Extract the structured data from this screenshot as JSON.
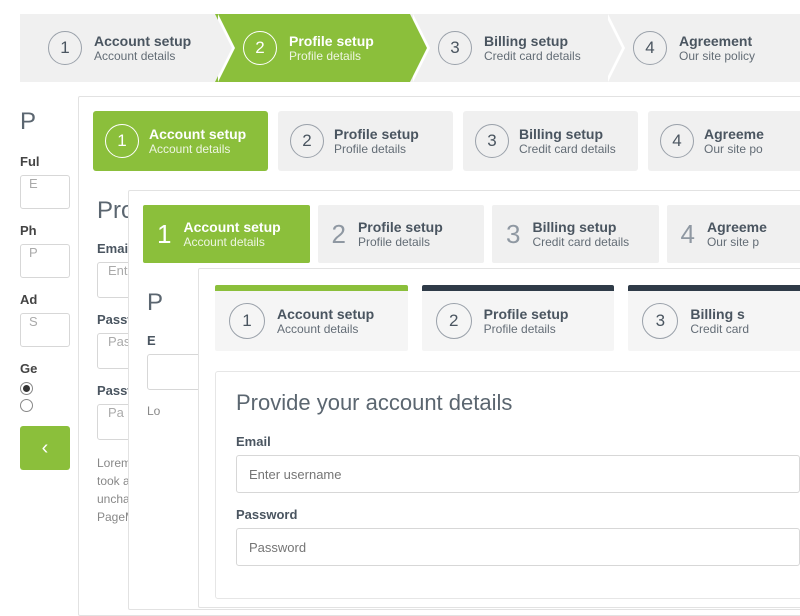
{
  "colors": {
    "accent": "#8bbf3b",
    "dark": "#2f3b48",
    "muted": "#f0f0f0"
  },
  "wizA": {
    "active": 2,
    "steps": [
      {
        "n": "1",
        "title": "Account setup",
        "sub": "Account details"
      },
      {
        "n": "2",
        "title": "Profile setup",
        "sub": "Profile details"
      },
      {
        "n": "3",
        "title": "Billing setup",
        "sub": "Credit card details"
      },
      {
        "n": "4",
        "title": "Agreement",
        "sub": "Our site policy"
      }
    ]
  },
  "layer1": {
    "heading": "P",
    "fields": {
      "fullname": {
        "label": "Ful",
        "value": "E"
      },
      "phone": {
        "label": "Ph",
        "value": "P"
      },
      "address": {
        "label": "Ad",
        "value": "S"
      },
      "gender": {
        "label": "Ge",
        "options": [
          "",
          ""
        ],
        "selected": 0
      }
    },
    "back_icon": "‹"
  },
  "wizB": {
    "active": 1,
    "steps": [
      {
        "n": "1",
        "title": "Account setup",
        "sub": "Account details"
      },
      {
        "n": "2",
        "title": "Profile setup",
        "sub": "Profile details"
      },
      {
        "n": "3",
        "title": "Billing setup",
        "sub": "Credit card details"
      },
      {
        "n": "4",
        "title": "Agreeme",
        "sub": "Our site po"
      }
    ]
  },
  "layer2": {
    "heading": "Prov",
    "email": {
      "label": "Email",
      "placeholder": "Ente"
    },
    "pass1": {
      "label": "Passw",
      "placeholder": "Pass"
    },
    "pass2": {
      "label": "Passw",
      "placeholder": "Pa"
    },
    "lorem": "Lorem \ntook a g\nunchan\nPageM"
  },
  "wizC": {
    "active": 1,
    "steps": [
      {
        "n": "1",
        "title": "Account setup",
        "sub": "Account details"
      },
      {
        "n": "2",
        "title": "Profile setup",
        "sub": "Profile details"
      },
      {
        "n": "3",
        "title": "Billing setup",
        "sub": "Credit card details"
      },
      {
        "n": "4",
        "title": "Agreeme",
        "sub": "Our site p"
      }
    ]
  },
  "layer3": {
    "heading": "P",
    "email": {
      "label": "E",
      "placeholder": ""
    },
    "lorem": "Lo"
  },
  "wizD": {
    "steps": [
      {
        "n": "1",
        "title": "Account setup",
        "sub": "Account details"
      },
      {
        "n": "2",
        "title": "Profile setup",
        "sub": "Profile details"
      },
      {
        "n": "3",
        "title": "Billing s",
        "sub": "Credit card"
      }
    ]
  },
  "layer4": {
    "heading": "Provide your account details",
    "email": {
      "label": "Email",
      "placeholder": "Enter username"
    },
    "password": {
      "label": "Password",
      "placeholder": "Password"
    }
  }
}
